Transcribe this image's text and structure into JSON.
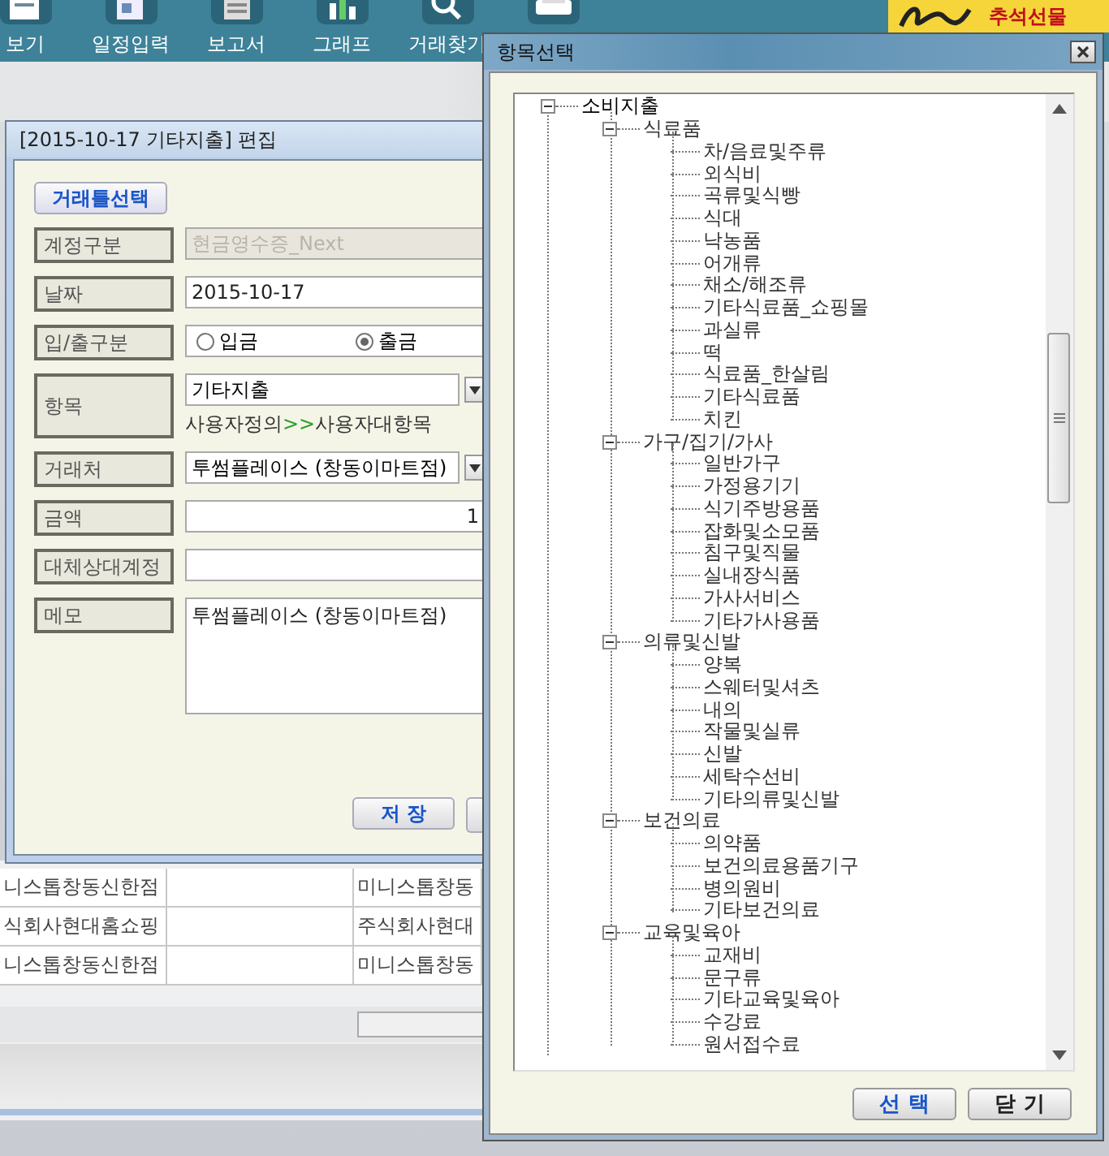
{
  "toolbar": [
    {
      "kind": "view",
      "label": "보기"
    },
    {
      "kind": "schedule",
      "label": "일정입력"
    },
    {
      "kind": "report",
      "label": "보고서"
    },
    {
      "kind": "graph",
      "label": "그래프"
    },
    {
      "kind": "search",
      "label": "거래찾기"
    },
    {
      "kind": "print"
    }
  ],
  "banner": {
    "text": "추석선물"
  },
  "edit_dialog": {
    "title": "[2015-10-17 기타지출] 편집",
    "template_button": "거래틀선택",
    "fields": [
      {
        "kind": "text",
        "label": "계정구분",
        "value": "현금영수증_Next",
        "disabled": true
      },
      {
        "kind": "text",
        "label": "날짜",
        "value": "2015-10-17",
        "disabled": false
      },
      {
        "kind": "radio",
        "label": "입/출구분",
        "options": [
          {
            "label": "입금",
            "selected": false
          },
          {
            "label": "출금",
            "selected": true
          }
        ]
      },
      {
        "kind": "category",
        "label": "항목",
        "value": "기타지출",
        "path": {
          "parent": "사용자정의",
          "separator": ">>",
          "child": "사용자대항목"
        }
      },
      {
        "kind": "dropdown",
        "label": "거래처",
        "value": "투썸플레이스 (창동이마트점)"
      },
      {
        "kind": "amount",
        "label": "금액",
        "value": "1"
      },
      {
        "kind": "text",
        "label": "대체상대계정",
        "disabled": false
      },
      {
        "kind": "memo",
        "label": "메모",
        "value": "투썸플레이스 (창동이마트점)"
      }
    ],
    "save_button": "저 장"
  },
  "table": {
    "rows": [
      {
        "column_1": "니스톱창동신한점",
        "column_3": "미니스톱창동"
      },
      {
        "column_1": "식회사현대홈쇼핑",
        "column_3": "주식회사현대"
      },
      {
        "column_1": "니스톱창동신한점",
        "column_3": "미니스톱창동"
      }
    ]
  },
  "item_dialog": {
    "title": "항목선택",
    "tree": [
      {
        "label": "소비지출",
        "expanded": true,
        "children": [
          {
            "label": "식료품",
            "expanded": true,
            "children": [
              {
                "label": "차/음료및주류"
              },
              {
                "label": "외식비"
              },
              {
                "label": "곡류및식빵"
              },
              {
                "label": "식대"
              },
              {
                "label": "낙농품"
              },
              {
                "label": "어개류"
              },
              {
                "label": "채소/해조류"
              },
              {
                "label": "기타식료품_쇼핑몰"
              },
              {
                "label": "과실류"
              },
              {
                "label": "떡"
              },
              {
                "label": "식료품_한살림"
              },
              {
                "label": "기타식료품"
              },
              {
                "label": "치킨"
              }
            ]
          },
          {
            "label": "가구/집기/가사",
            "expanded": true,
            "children": [
              {
                "label": "일반가구"
              },
              {
                "label": "가정용기기"
              },
              {
                "label": "식기주방용품"
              },
              {
                "label": "잡화및소모품"
              },
              {
                "label": "침구및직물"
              },
              {
                "label": "실내장식품"
              },
              {
                "label": "가사서비스"
              },
              {
                "label": "기타가사용품"
              }
            ]
          },
          {
            "label": "의류및신발",
            "expanded": true,
            "children": [
              {
                "label": "양복"
              },
              {
                "label": "스웨터및셔츠"
              },
              {
                "label": "내의"
              },
              {
                "label": "작물및실류"
              },
              {
                "label": "신발"
              },
              {
                "label": "세탁수선비"
              },
              {
                "label": "기타의류및신발"
              }
            ]
          },
          {
            "label": "보건의료",
            "expanded": true,
            "children": [
              {
                "label": "의약품"
              },
              {
                "label": "보건의료용품기구"
              },
              {
                "label": "병의원비"
              },
              {
                "label": "기타보건의료"
              }
            ]
          },
          {
            "label": "교육및육아",
            "expanded": true,
            "children": [
              {
                "label": "교재비"
              },
              {
                "label": "문구류"
              },
              {
                "label": "기타교육및육아"
              },
              {
                "label": "수강료"
              },
              {
                "label": "원서접수료"
              }
            ]
          }
        ]
      }
    ],
    "buttons": [
      "선 택",
      "닫 기"
    ]
  }
}
